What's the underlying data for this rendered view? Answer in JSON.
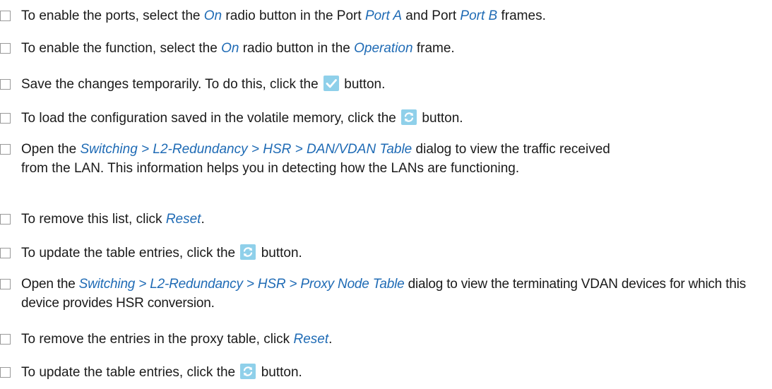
{
  "steps": [
    {
      "parts": [
        "To enable the ports, select the ",
        "On",
        " radio button in the Port ",
        "Port A",
        " and Port ",
        "Port B",
        " frames."
      ]
    },
    {
      "parts": [
        "To enable the function, select the ",
        "On",
        " radio button in the ",
        "Operation",
        " frame."
      ]
    },
    {
      "parts": [
        "Save the changes temporarily. To do this, click the ",
        " button."
      ],
      "icon": "checkmark-icon"
    },
    {
      "parts": [
        "To load the configuration saved in the volatile memory, click the ",
        " button."
      ],
      "icon": "refresh-icon"
    },
    {
      "parts": [
        "Open the ",
        "Switching > L2-Redundancy > HSR > DAN/VDAN Table",
        " dialog to view the traffic received from the LAN. This information helps you in detecting how the LANs are functioning."
      ]
    },
    {
      "parts": [
        "To remove this list, click ",
        "Reset",
        "."
      ]
    },
    {
      "parts": [
        "To update the table entries, click the ",
        " button."
      ],
      "icon": "refresh-icon"
    },
    {
      "parts": [
        "Open the ",
        "Switching > L2-Redundancy > HSR > Proxy Node Table",
        " dialog to view the terminating VDAN devices for which this device provides HSR conversion."
      ]
    },
    {
      "parts": [
        "To remove the entries in the proxy table, click ",
        "Reset",
        "."
      ]
    },
    {
      "parts": [
        "To update the table entries, click the ",
        " button."
      ],
      "icon": "refresh-icon"
    }
  ],
  "colors": {
    "emphasis": "#1f6bb5",
    "icon_bg": "#8fd0ea",
    "check": "#ffffff",
    "refresh_arrow": "#ffffff"
  }
}
